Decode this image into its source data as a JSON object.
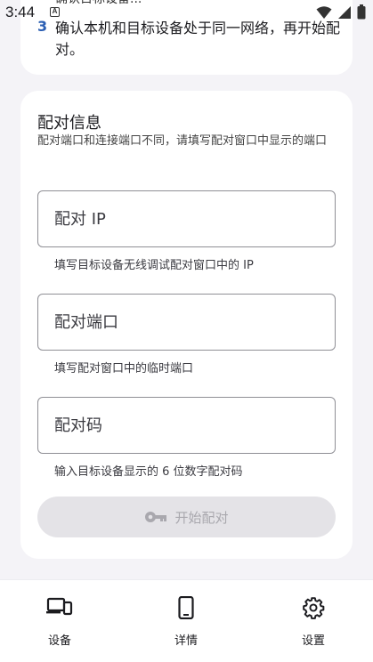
{
  "status_bar": {
    "time": "3:44",
    "notification_badge": "A"
  },
  "steps_card": {
    "clipped_text": "确认目标设备...",
    "step_number": "3",
    "step_text": "确认本机和目标设备处于同一网络，再开始配对。"
  },
  "pairing": {
    "title": "配对信息",
    "description": "配对端口和连接端口不同，请填写配对窗口中显示的端口",
    "ip_placeholder": "配对 IP",
    "ip_value": "",
    "ip_helper": "填写目标设备无线调试配对窗口中的 IP",
    "port_placeholder": "配对端口",
    "port_value": "",
    "port_helper": "填写配对窗口中的临时端口",
    "code_placeholder": "配对码",
    "code_value": "",
    "code_helper": "输入目标设备显示的 6 位数字配对码",
    "start_label": "开始配对",
    "start_icon": "key-icon"
  },
  "nav": {
    "items": [
      {
        "label": "设备",
        "icon": "devices-icon"
      },
      {
        "label": "详情",
        "icon": "phone-icon"
      },
      {
        "label": "设置",
        "icon": "gear-icon"
      }
    ]
  },
  "colors": {
    "background": "#f4f3f7",
    "card": "#ffffff",
    "accent": "#2b5fb3",
    "disabled_button": "#e4e3e7",
    "disabled_text": "#a9a8ae"
  }
}
